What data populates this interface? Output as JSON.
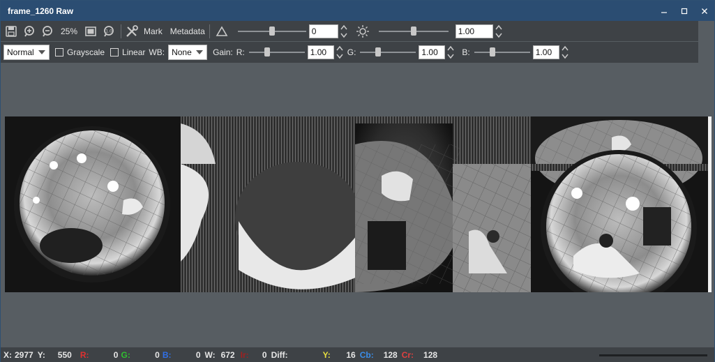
{
  "window": {
    "title": "frame_1260 Raw",
    "controls": [
      "minimize",
      "maximize",
      "close"
    ]
  },
  "toolbar1": {
    "zoom": "25%",
    "mark_label": "Mark",
    "metadata_label": "Metadata",
    "contrast_value": "0",
    "contrast_level": 0.5,
    "brightness_value": "1.00",
    "brightness_level": 0.5
  },
  "toolbar2": {
    "mode_select": "Normal",
    "grayscale_label": "Grayscale",
    "linear_label": "Linear",
    "wb_label": "WB:",
    "wb_select": "None",
    "gain_label": "Gain:",
    "r_label": "R:",
    "r_value": "1.00",
    "g_label": "G:",
    "g_value": "1.00",
    "b_label": "B:",
    "b_value": "1.00"
  },
  "status": {
    "x_label": "X:",
    "x_value": "2977",
    "y_label": "Y:",
    "y_value": "550",
    "r_label": "R:",
    "r_value": "0",
    "g_label": "G:",
    "g_value": "0",
    "b_label": "B:",
    "b_value": "0",
    "w_label": "W:",
    "w_value": "672",
    "ir_label": "Ir:",
    "ir_value": "0",
    "diff_label": "Diff:",
    "yy_label": "Y:",
    "yy_value": "16",
    "cb_label": "Cb:",
    "cb_value": "128",
    "cr_label": "Cr:",
    "cr_value": "128"
  },
  "colors": {
    "titlebar": "#2b4d72",
    "r_label": "#e03030",
    "g_label": "#30c030",
    "b_label": "#3070e8",
    "ir_label": "#a02020",
    "yy_label": "#e8e040",
    "cb_label": "#3b8de8",
    "cr_label": "#e04040"
  }
}
